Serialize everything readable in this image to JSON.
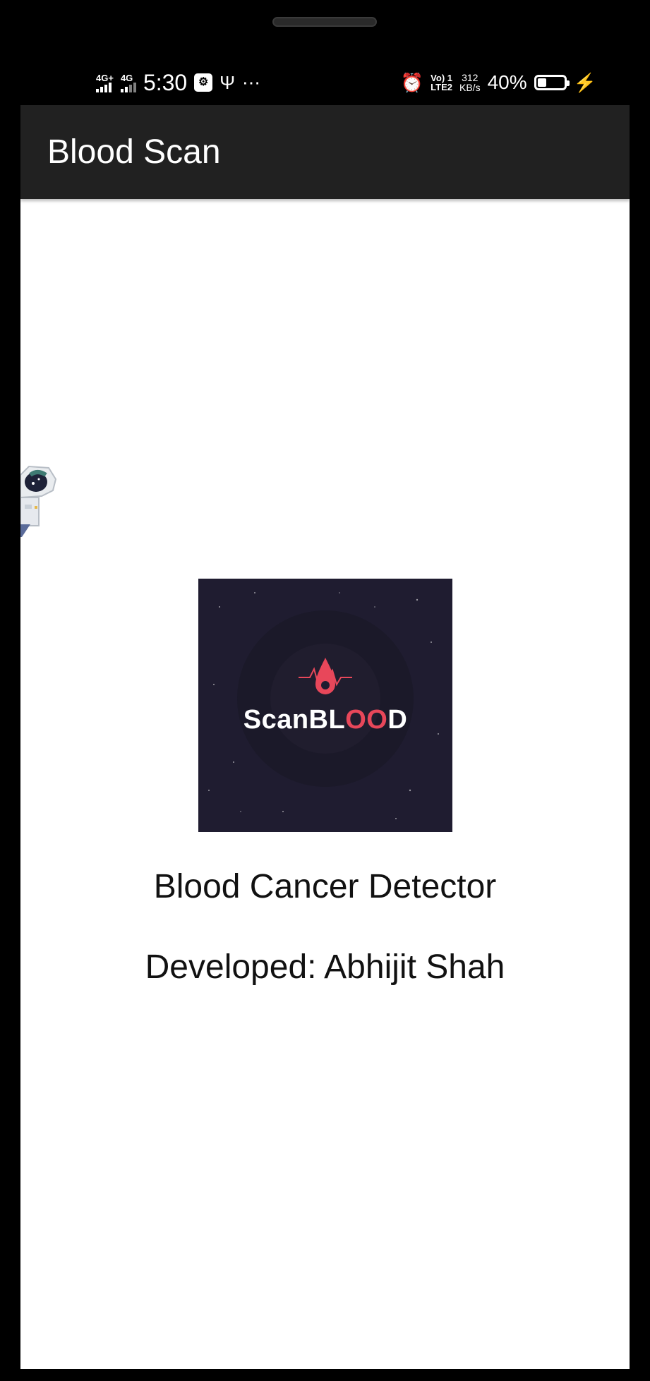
{
  "status_bar": {
    "net1": "4G+",
    "net2": "4G",
    "time": "5:30",
    "volte_top": "Vo) 1",
    "volte_bottom": "LTE2",
    "speed_value": "312",
    "speed_unit": "KB/s",
    "battery_percent_text": "40%",
    "battery_level": 0.4
  },
  "app_bar": {
    "title": "Blood Scan"
  },
  "logo": {
    "word_plain": "ScanBL",
    "word_red": "OO",
    "word_end": "D"
  },
  "main": {
    "caption1": "Blood Cancer Detector",
    "caption2": "Developed: Abhijit Shah"
  }
}
